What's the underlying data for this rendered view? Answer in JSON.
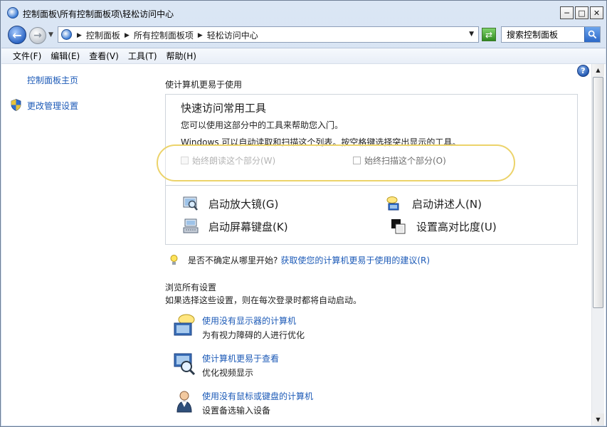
{
  "window": {
    "title": "控制面板\\所有控制面板项\\轻松访问中心",
    "min_label": "─",
    "max_label": "□",
    "close_label": "✕"
  },
  "nav": {
    "back_glyph": "←",
    "forward_glyph": "→",
    "dropdown_glyph": "▼",
    "breadcrumbs": [
      "控制面板",
      "所有控制面板项",
      "轻松访问中心"
    ],
    "sep_glyph": "▶",
    "refresh_glyph": "⇄"
  },
  "search": {
    "placeholder": "搜索控制面板"
  },
  "menu": [
    "文件(F)",
    "编辑(E)",
    "查看(V)",
    "工具(T)",
    "帮助(H)"
  ],
  "sidebar": {
    "items": [
      {
        "label": "控制面板主页"
      },
      {
        "label": "更改管理设置"
      }
    ]
  },
  "help": {
    "glyph": "?"
  },
  "main": {
    "section_title": "使计算机更易于使用",
    "quick": {
      "title": "快速访问常用工具",
      "desc1": "您可以使用这部分中的工具来帮助您入门。",
      "desc2": "Windows 可以自动读取和扫描这个列表。按空格键选择突出显示的工具。",
      "checkbox_read": {
        "label": "始终朗读这个部分(W)",
        "checked": false,
        "disabled": true
      },
      "checkbox_scan": {
        "label": "始终扫描这个部分(O)",
        "checked": false,
        "disabled": false
      }
    },
    "tools": [
      {
        "label": "启动放大镜(G)",
        "icon": "magnifier-icon"
      },
      {
        "label": "启动讲述人(N)",
        "icon": "narrator-icon"
      },
      {
        "label": "启动屏幕键盘(K)",
        "icon": "keyboard-icon"
      },
      {
        "label": "设置高对比度(U)",
        "icon": "contrast-icon"
      }
    ],
    "hint": {
      "text": "是否不确定从哪里开始?",
      "link": "获取使您的计算机更易于使用的建议(R)"
    },
    "browse_title": "浏览所有设置",
    "browse_desc": "如果选择这些设置，则在每次登录时都将自动启动。",
    "settings": [
      {
        "link": "使用没有显示器的计算机",
        "desc": "为有视力障碍的人进行优化"
      },
      {
        "link": "使计算机更易于查看",
        "desc": "优化视频显示"
      },
      {
        "link": "使用没有鼠标或键盘的计算机",
        "desc": "设置备选输入设备"
      }
    ]
  },
  "scrollbar": {
    "up_glyph": "▲",
    "down_glyph": "▼"
  },
  "colors": {
    "link": "#1c5ab7",
    "frame": "#c9d9ee",
    "highlight": "#ecd36a"
  }
}
